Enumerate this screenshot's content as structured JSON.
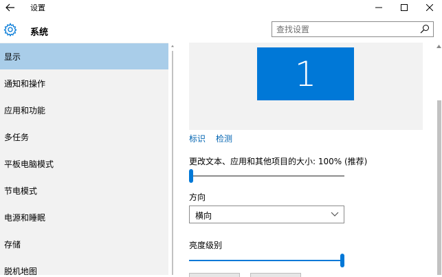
{
  "window": {
    "title": "设置",
    "back_icon": "back-arrow-icon",
    "minimize_icon": "minimize-icon",
    "maximize_icon": "maximize-icon",
    "close_icon": "close-icon"
  },
  "header": {
    "icon": "gear-icon",
    "title": "系统",
    "search_placeholder": "查找设置",
    "search_value": "",
    "search_icon": "search-icon"
  },
  "sidebar": {
    "items": [
      {
        "label": "显示",
        "selected": true
      },
      {
        "label": "通知和操作",
        "selected": false
      },
      {
        "label": "应用和功能",
        "selected": false
      },
      {
        "label": "多任务",
        "selected": false
      },
      {
        "label": "平板电脑模式",
        "selected": false
      },
      {
        "label": "节电模式",
        "selected": false
      },
      {
        "label": "电源和睡眠",
        "selected": false
      },
      {
        "label": "存储",
        "selected": false
      },
      {
        "label": "脱机地图",
        "selected": false
      }
    ]
  },
  "display": {
    "monitor_number": "1",
    "identify_link": "标识",
    "detect_link": "检测",
    "scale_label": "更改文本、应用和其他项目的大小: 100% (推荐)",
    "scale_slider_fraction": 0.0,
    "orientation_label": "方向",
    "orientation_value": "横向",
    "brightness_label": "亮度级别",
    "brightness_fraction": 1.0
  },
  "colors": {
    "accent": "#0078d7",
    "selected_item_bg": "#a9cde9",
    "sidebar_bg": "#f2f2f2",
    "link": "#0063b1"
  }
}
